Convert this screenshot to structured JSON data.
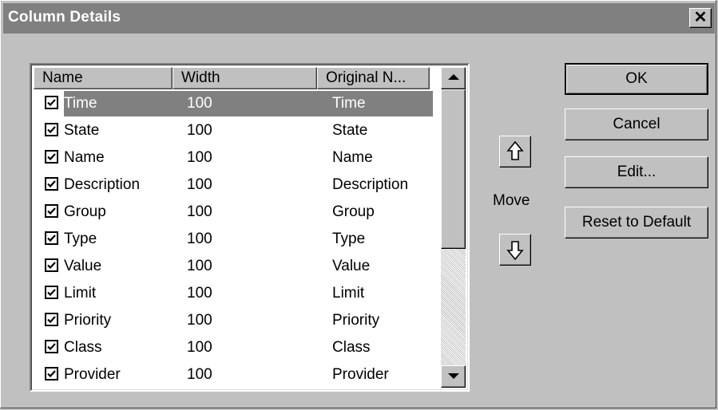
{
  "window": {
    "title": "Column Details"
  },
  "list": {
    "columns": [
      "Name",
      "Width",
      "Original N..."
    ],
    "rows": [
      {
        "checked": true,
        "name": "Time",
        "width": "100",
        "original": "Time",
        "selected": true
      },
      {
        "checked": true,
        "name": "State",
        "width": "100",
        "original": "State"
      },
      {
        "checked": true,
        "name": "Name",
        "width": "100",
        "original": "Name"
      },
      {
        "checked": true,
        "name": "Description",
        "width": "100",
        "original": "Description"
      },
      {
        "checked": true,
        "name": "Group",
        "width": "100",
        "original": "Group"
      },
      {
        "checked": true,
        "name": "Type",
        "width": "100",
        "original": "Type"
      },
      {
        "checked": true,
        "name": "Value",
        "width": "100",
        "original": "Value"
      },
      {
        "checked": true,
        "name": "Limit",
        "width": "100",
        "original": "Limit"
      },
      {
        "checked": true,
        "name": "Priority",
        "width": "100",
        "original": "Priority"
      },
      {
        "checked": true,
        "name": "Class",
        "width": "100",
        "original": "Class"
      },
      {
        "checked": true,
        "name": "Provider",
        "width": "100",
        "original": "Provider"
      }
    ]
  },
  "move": {
    "label": "Move",
    "up_icon": "arrow-up-icon",
    "down_icon": "arrow-down-icon"
  },
  "buttons": {
    "ok": "OK",
    "cancel": "Cancel",
    "edit": "Edit...",
    "reset": "Reset to Default"
  },
  "icons": {
    "close": "close-icon"
  },
  "colors": {
    "titlebar": "#808080",
    "selection": "#808080",
    "face": "#c0c0c0"
  }
}
